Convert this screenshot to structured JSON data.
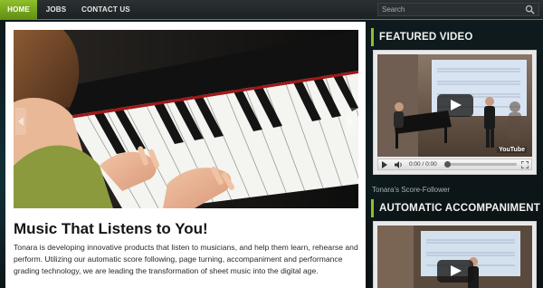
{
  "nav": {
    "items": [
      {
        "label": "HOME",
        "active": true
      },
      {
        "label": "JOBS",
        "active": false
      },
      {
        "label": "CONTACT US",
        "active": false
      }
    ]
  },
  "search": {
    "placeholder": "Search",
    "icon": "search-icon"
  },
  "main": {
    "headline": "Music That Listens to You!",
    "intro": "Tonara is developing innovative products that listen to musicians, and help them learn, rehearse and perform. Utilizing our automatic score following, page turning, accompaniment and performance grading technology, we are leading the transformation of sheet music into the digital age."
  },
  "sidebar": {
    "featured_title": "FEATURED VIDEO",
    "featured_time": "0:00 / 0:00",
    "featured_caption": "Tonara's Score-Follower",
    "featured_logo": "YouTube",
    "accomp_title": "AUTOMATIC ACCOMPANIMENT"
  },
  "colors": {
    "accent": "#8fbf2a",
    "topbar": "#23292b",
    "background": "#0c1416",
    "panel": "#ffffff"
  }
}
